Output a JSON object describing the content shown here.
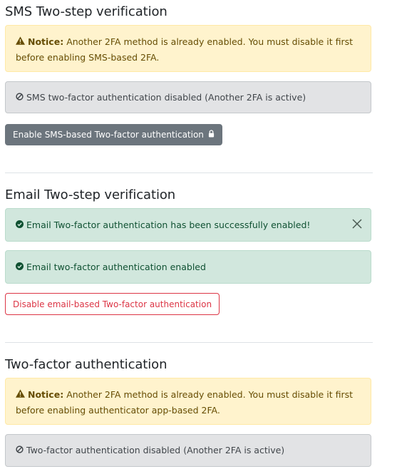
{
  "sms": {
    "heading": "SMS Two-step verification",
    "notice": {
      "label": "Notice:",
      "text": "Another 2FA method is already enabled. You must disable it first before enabling SMS-based 2FA."
    },
    "status": "SMS two-factor authentication disabled (Another 2FA is active)",
    "button": "Enable SMS-based Two-factor authentication",
    "button_icon": "lock-icon"
  },
  "email": {
    "heading": "Email Two-step verification",
    "success_alert": "Email Two-factor authentication has been successfully enabled!",
    "status": "Email two-factor authentication enabled",
    "button": "Disable email-based Two-factor authentication"
  },
  "app": {
    "heading": "Two-factor authentication",
    "notice": {
      "label": "Notice:",
      "text": "Another 2FA method is already enabled. You must disable it first before enabling authenticator app-based 2FA."
    },
    "status": "Two-factor authentication disabled (Another 2FA is active)"
  },
  "colors": {
    "warning_bg": "#fff3cd",
    "secondary_bg": "#e2e3e5",
    "success_bg": "#d1e7dd",
    "danger": "#dc3545",
    "button_gray": "#6c757d"
  }
}
